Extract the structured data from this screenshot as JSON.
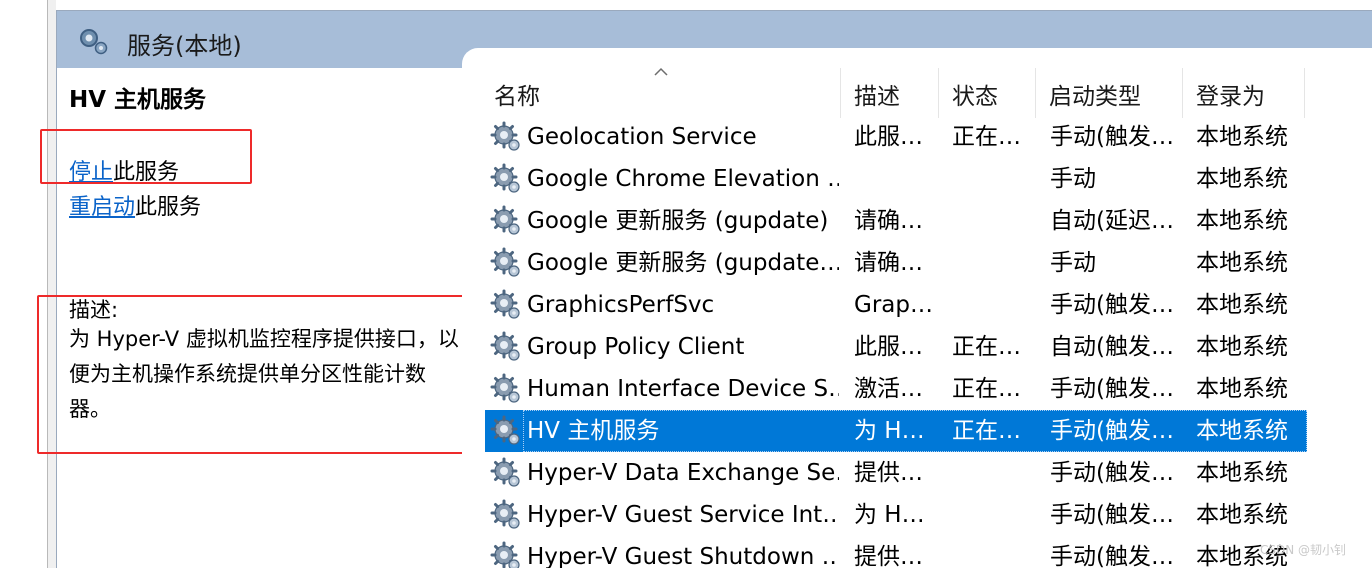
{
  "window": {
    "title": "服务(本地)"
  },
  "details": {
    "service_name": "HV 主机服务",
    "actions": [
      {
        "link": "停止",
        "suffix": "此服务"
      },
      {
        "link": "重启动",
        "suffix": "此服务"
      }
    ],
    "description_label": "描述:",
    "description_text": "为 Hyper-V 虚拟机监控程序提供接口，以便为主机操作系统提供单分区性能计数器。"
  },
  "table": {
    "columns": [
      "名称",
      "描述",
      "状态",
      "启动类型",
      "登录为"
    ],
    "sort_column": "名称",
    "sort_direction": "ascending",
    "selected_row": "HV 主机服务",
    "rows": [
      {
        "name": "Geolocation Service",
        "desc": "此服…",
        "status": "正在…",
        "startup": "手动(触发…",
        "logon": "本地系统"
      },
      {
        "name": "Google Chrome Elevation …",
        "desc": "",
        "status": "",
        "startup": "手动",
        "logon": "本地系统"
      },
      {
        "name": "Google 更新服务 (gupdate)",
        "desc": "请确…",
        "status": "",
        "startup": "自动(延迟…",
        "logon": "本地系统"
      },
      {
        "name": "Google 更新服务 (gupdate…",
        "desc": "请确…",
        "status": "",
        "startup": "手动",
        "logon": "本地系统"
      },
      {
        "name": "GraphicsPerfSvc",
        "desc": "Grap…",
        "status": "",
        "startup": "手动(触发…",
        "logon": "本地系统"
      },
      {
        "name": "Group Policy Client",
        "desc": "此服…",
        "status": "正在…",
        "startup": "自动(触发…",
        "logon": "本地系统"
      },
      {
        "name": "Human Interface Device S…",
        "desc": "激活…",
        "status": "正在…",
        "startup": "手动(触发…",
        "logon": "本地系统"
      },
      {
        "name": "HV 主机服务",
        "desc": "为 H…",
        "status": "正在…",
        "startup": "手动(触发…",
        "logon": "本地系统"
      },
      {
        "name": "Hyper-V Data Exchange Se…",
        "desc": "提供…",
        "status": "",
        "startup": "手动(触发…",
        "logon": "本地系统"
      },
      {
        "name": "Hyper-V Guest Service Int…",
        "desc": "为 H…",
        "status": "",
        "startup": "手动(触发…",
        "logon": "本地系统"
      },
      {
        "name": "Hyper-V Guest Shutdown …",
        "desc": "提供…",
        "status": "",
        "startup": "手动(触发…",
        "logon": "本地系统"
      }
    ]
  },
  "watermark": "CSDN @韧小钊",
  "colors": {
    "title_bar": "#a7bdd8",
    "selection": "#0078d7",
    "link": "#0a63c9",
    "annotation_box": "#ee2a2a"
  },
  "icons": {
    "title": "services-gears-icon",
    "row": "service-gear-icon",
    "sort": "sort-ascending-caret-icon"
  }
}
